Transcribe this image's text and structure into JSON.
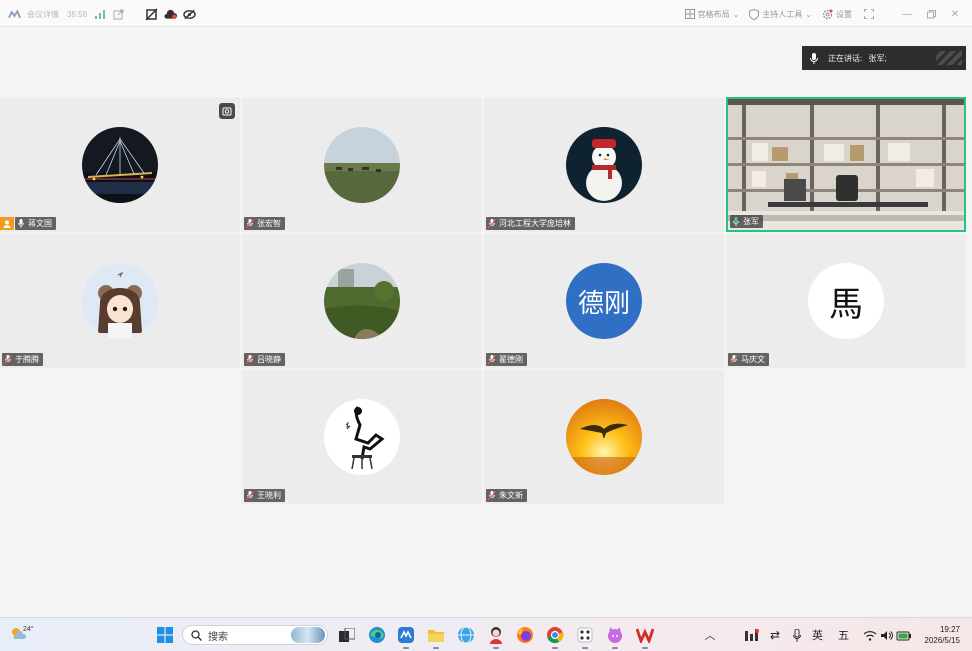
{
  "topbar": {
    "meeting_details": "会议详情",
    "duration": "35:58",
    "grid_layout": "宫格布局",
    "host_tools": "主持人工具",
    "settings": "设置"
  },
  "speaking": {
    "label": "正在讲话:",
    "name": "张军;"
  },
  "participants": [
    {
      "name": "蒋文国",
      "avatar": "night-bridge"
    },
    {
      "name": "张宏智",
      "avatar": "grassland-horses"
    },
    {
      "name": "河北工程大学庞培林",
      "avatar": "snowman"
    },
    {
      "name": "张军",
      "avatar": "office-video"
    },
    {
      "name": "于腾腾",
      "avatar": "cartoon-girl"
    },
    {
      "name": "吕晓静",
      "avatar": "field-trees"
    },
    {
      "name": "翟德刚",
      "avatar": "text-avatar",
      "avatar_text": "德刚"
    },
    {
      "name": "马庆文",
      "avatar": "text-avatar",
      "avatar_text": "馬"
    },
    {
      "name": "王晓利",
      "avatar": "sketch-figure"
    },
    {
      "name": "朱文新",
      "avatar": "sunset-bird"
    }
  ],
  "colors": {
    "active_border": "#27c281",
    "host_badge": "#f39c1c",
    "text_avatar_blue": "#2f6fc4"
  },
  "taskbar": {
    "weather_temp": "24°",
    "search_placeholder": "搜索",
    "ime_lang": "英",
    "ime_mode": "五",
    "time": "19:27",
    "date": "2026/5/15"
  }
}
